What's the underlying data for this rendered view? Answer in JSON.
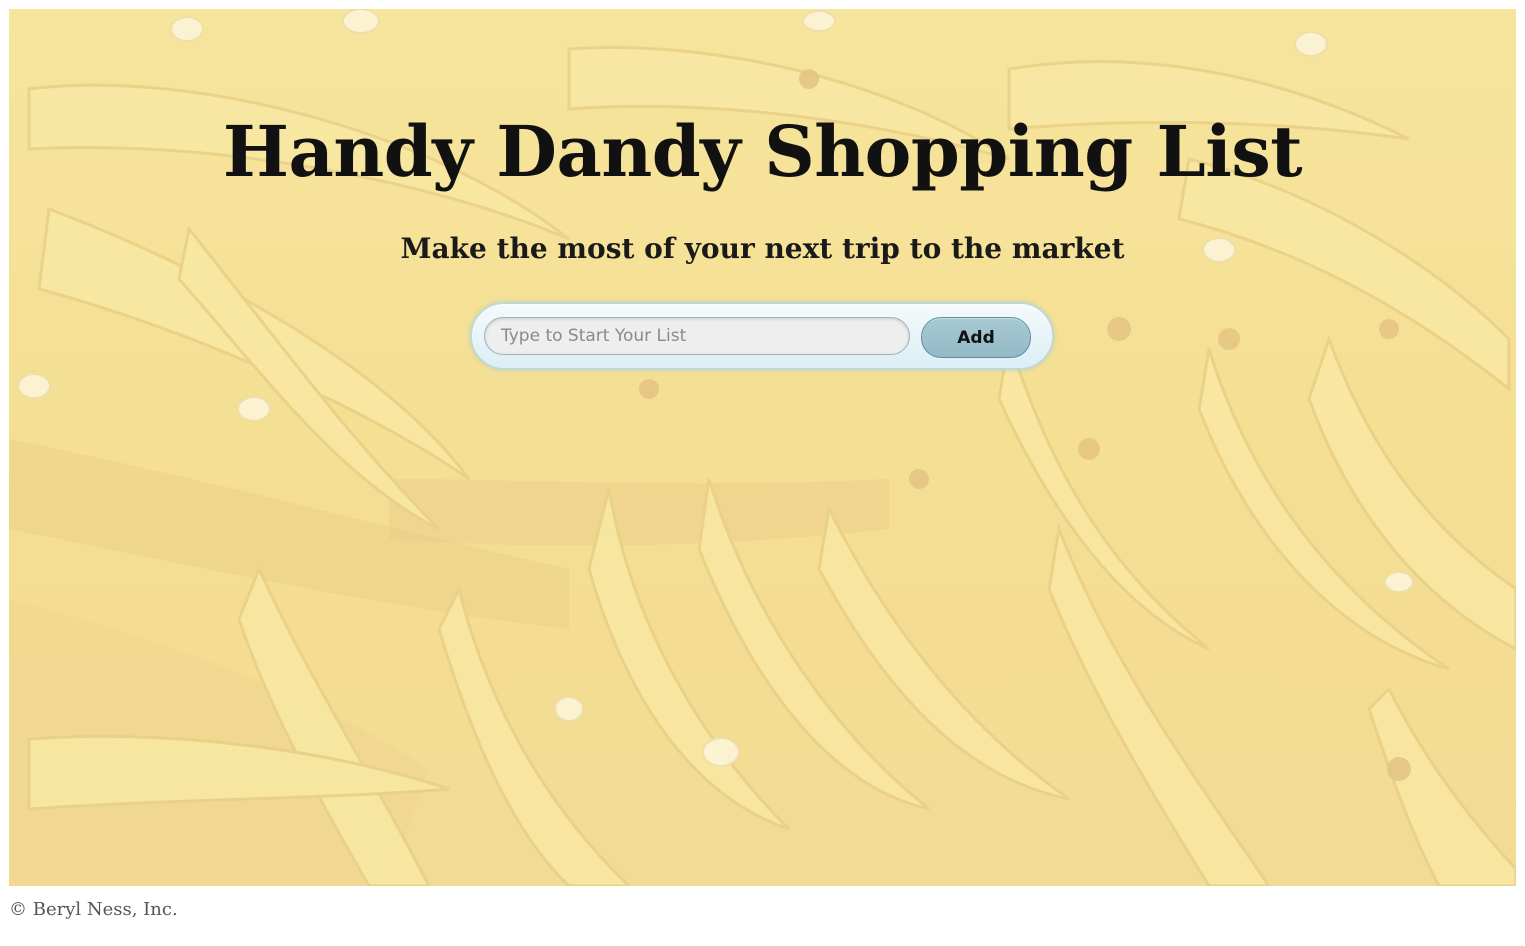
{
  "header": {
    "title": "Handy Dandy Shopping List",
    "subtitle": "Make the most of your next trip to the market"
  },
  "form": {
    "input_placeholder": "Type to Start Your List",
    "input_value": "",
    "add_label": "Add"
  },
  "footer": {
    "copyright": "© Beryl Ness, Inc."
  },
  "colors": {
    "hero_tint": "#f2dc8c",
    "button": "#9fc0cc",
    "pill": "#e6f2f8"
  },
  "icons": {
    "background": "bananas-photo"
  }
}
